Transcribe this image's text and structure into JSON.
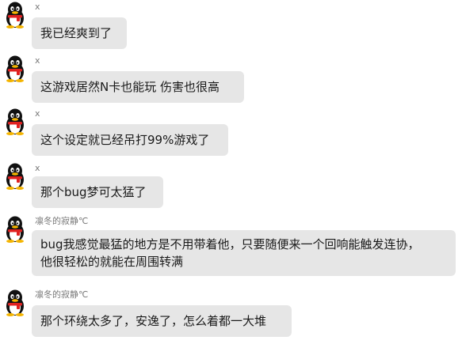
{
  "messages": [
    {
      "sender": "x",
      "lines": [
        "我已经爽到了"
      ]
    },
    {
      "sender": "x",
      "lines": [
        "这游戏居然N卡也能玩 伤害也很高"
      ]
    },
    {
      "sender": "x",
      "lines": [
        "这个设定就已经吊打99%游戏了"
      ]
    },
    {
      "sender": "x",
      "lines": [
        "那个bug梦可太猛了"
      ]
    },
    {
      "sender": "凛冬的寂静℃",
      "lines": [
        "bug我感觉最猛的地方是不用带着他，只要随便来一个回响能触发连协，",
        "他很轻松的就能在周围转满"
      ]
    },
    {
      "sender": "凛冬的寂静℃",
      "lines": [
        "那个环绕太多了，安逸了，怎么着都一大堆"
      ]
    }
  ],
  "colors": {
    "bubble": "#e6e6e6",
    "sender_text": "#7a7a7a",
    "message_text": "#1a1a1a"
  },
  "icons": {
    "avatar": "qq-penguin-avatar-icon"
  }
}
